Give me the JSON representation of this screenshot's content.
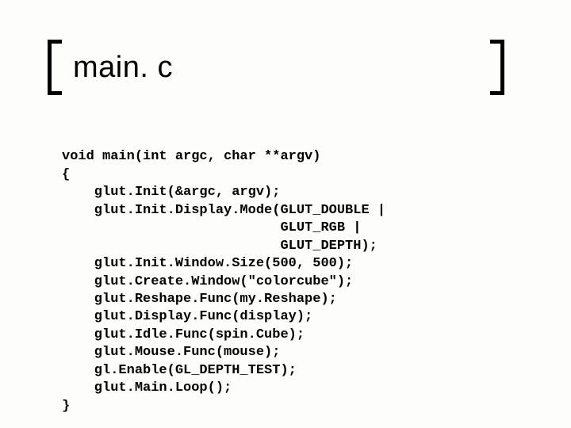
{
  "title": "main. c",
  "code": {
    "l1": "void main(int argc, char **argv)",
    "l2": "{",
    "l3": "    glut.Init(&argc, argv);",
    "l4": "    glut.Init.Display.Mode(GLUT_DOUBLE |",
    "l5": "                           GLUT_RGB |",
    "l6": "                           GLUT_DEPTH);",
    "l7": "    glut.Init.Window.Size(500, 500);",
    "l8": "    glut.Create.Window(\"colorcube\");",
    "l9": "    glut.Reshape.Func(my.Reshape);",
    "l10": "    glut.Display.Func(display);",
    "l11": "    glut.Idle.Func(spin.Cube);",
    "l12": "    glut.Mouse.Func(mouse);",
    "l13": "    gl.Enable(GL_DEPTH_TEST);",
    "l14": "    glut.Main.Loop();",
    "l15": "}"
  }
}
